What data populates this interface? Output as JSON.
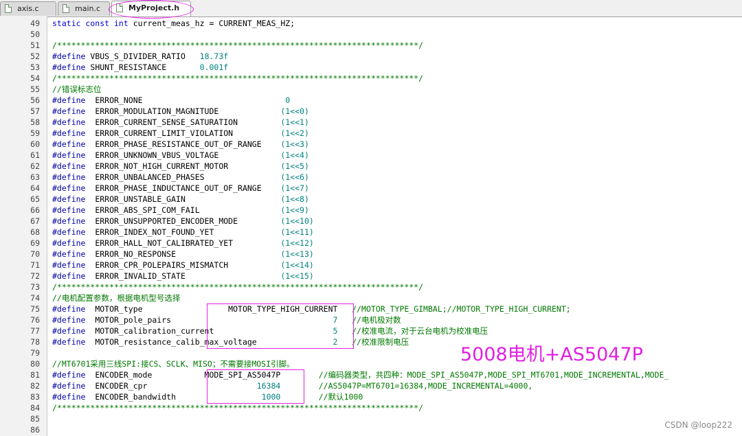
{
  "tabs": [
    {
      "label": "axis.c",
      "active": false
    },
    {
      "label": "main.c",
      "active": false
    },
    {
      "label": "MyProject.h",
      "active": true
    }
  ],
  "lines": [
    {
      "n": "49",
      "code": "static const int current_meas_hz = CURRENT_MEAS_HZ;"
    },
    {
      "n": "50",
      "code": ""
    },
    {
      "n": "51",
      "code": "/****************************************************************************/"
    },
    {
      "n": "52",
      "code": "#define VBUS_S_DIVIDER_RATIO   18.73f"
    },
    {
      "n": "53",
      "code": "#define SHUNT_RESISTANCE       0.001f"
    },
    {
      "n": "54",
      "code": "/****************************************************************************/"
    },
    {
      "n": "55",
      "code": "//错误标志位"
    },
    {
      "n": "56",
      "code": "#define  ERROR_NONE                              0"
    },
    {
      "n": "57",
      "code": "#define  ERROR_MODULATION_MAGNITUDE             (1<<0)"
    },
    {
      "n": "58",
      "code": "#define  ERROR_CURRENT_SENSE_SATURATION         (1<<1)"
    },
    {
      "n": "59",
      "code": "#define  ERROR_CURRENT_LIMIT_VIOLATION          (1<<2)"
    },
    {
      "n": "60",
      "code": "#define  ERROR_PHASE_RESISTANCE_OUT_OF_RANGE    (1<<3)"
    },
    {
      "n": "61",
      "code": "#define  ERROR_UNKNOWN_VBUS_VOLTAGE             (1<<4)"
    },
    {
      "n": "62",
      "code": "#define  ERROR_NOT_HIGH_CURRENT_MOTOR           (1<<5)"
    },
    {
      "n": "63",
      "code": "#define  ERROR_UNBALANCED_PHASES                (1<<6)"
    },
    {
      "n": "64",
      "code": "#define  ERROR_PHASE_INDUCTANCE_OUT_OF_RANGE    (1<<7)"
    },
    {
      "n": "65",
      "code": "#define  ERROR_UNSTABLE_GAIN                    (1<<8)"
    },
    {
      "n": "66",
      "code": "#define  ERROR_ABS_SPI_COM_FAIL                 (1<<9)"
    },
    {
      "n": "67",
      "code": "#define  ERROR_UNSUPPORTED_ENCODER_MODE         (1<<10)"
    },
    {
      "n": "68",
      "code": "#define  ERROR_INDEX_NOT_FOUND_YET              (1<<11)"
    },
    {
      "n": "69",
      "code": "#define  ERROR_HALL_NOT_CALIBRATED_YET          (1<<12)"
    },
    {
      "n": "70",
      "code": "#define  ERROR_NO_RESPONSE                      (1<<13)"
    },
    {
      "n": "71",
      "code": "#define  ERROR_CPR_POLEPAIRS_MISMATCH           (1<<14)"
    },
    {
      "n": "72",
      "code": "#define  ERROR_INVALID_STATE                    (1<<15)"
    },
    {
      "n": "73",
      "code": "/****************************************************************************/"
    },
    {
      "n": "74",
      "code": "//电机配置参数，根据电机型号选择"
    },
    {
      "n": "75",
      "code": "#define  MOTOR_type                  MOTOR_TYPE_HIGH_CURRENT   //MOTOR_TYPE_GIMBAL;//MOTOR_TYPE_HIGH_CURRENT;"
    },
    {
      "n": "76",
      "code": "#define  MOTOR_pole_pairs                                  7   //电机极对数"
    },
    {
      "n": "77",
      "code": "#define  MOTOR_calibration_current                         5   //校准电流，对于云台电机为校准电压"
    },
    {
      "n": "78",
      "code": "#define  MOTOR_resistance_calib_max_voltage                2   //校准限制电压"
    },
    {
      "n": "79",
      "code": ""
    },
    {
      "n": "80",
      "code": "//MT6701采用三线SPI:接CS、SCLK、MISO；不需要接MOSI引脚。"
    },
    {
      "n": "81",
      "code": "#define  ENCODER_mode           MODE_SPI_AS5047P        //编码器类型，共四种：MODE_SPI_AS5047P,MODE_SPI_MT6701,MODE_INCREMENTAL,MODE_"
    },
    {
      "n": "82",
      "code": "#define  ENCODER_cpr                       16384        //AS5047P=MT6701=16384,MODE_INCREMENTAL=4000,"
    },
    {
      "n": "83",
      "code": "#define  ENCODER_bandwidth                  1000        //默认1000"
    },
    {
      "n": "84",
      "code": "/****************************************************************************/"
    },
    {
      "n": "85",
      "code": ""
    },
    {
      "n": "86",
      "code": ""
    }
  ],
  "annotation": "5008电机+AS5047P",
  "watermark": "CSDN @loop222",
  "colors": {
    "highlight": "#e020e0",
    "keyword": "#0000d8",
    "comment": "#007800",
    "number": "#008080"
  }
}
